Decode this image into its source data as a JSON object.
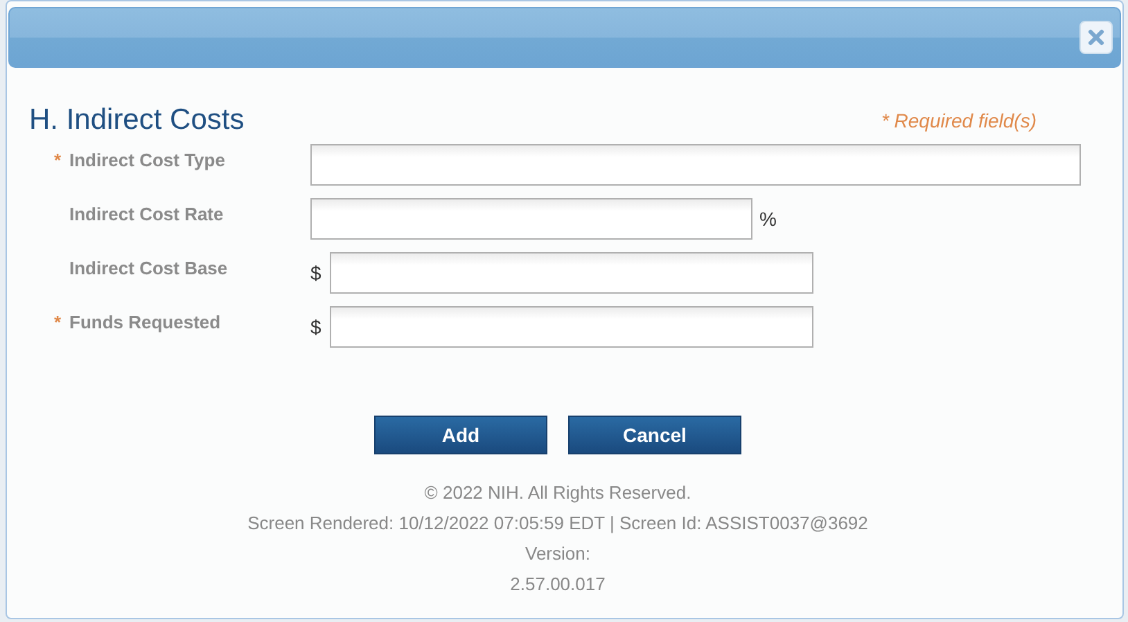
{
  "dialog": {
    "title": "H. Indirect Costs",
    "required_note": "* Required field(s)"
  },
  "fields": [
    {
      "label": "Indirect Cost Type",
      "required": true,
      "kind": "wide"
    },
    {
      "label": "Indirect Cost Rate",
      "required": false,
      "kind": "rate",
      "suffix": "%"
    },
    {
      "label": "Indirect Cost Base",
      "required": false,
      "kind": "amount",
      "prefix": "$"
    },
    {
      "label": "Funds Requested",
      "required": true,
      "kind": "amount",
      "prefix": "$"
    }
  ],
  "required_mark": "*",
  "buttons": [
    "Add",
    "Cancel"
  ],
  "footer": [
    "© 2022 NIH. All Rights Reserved.",
    "Screen Rendered: 10/12/2022 07:05:59 EDT | Screen Id: ASSIST0037@3692",
    "Version:",
    "2.57.00.017"
  ]
}
